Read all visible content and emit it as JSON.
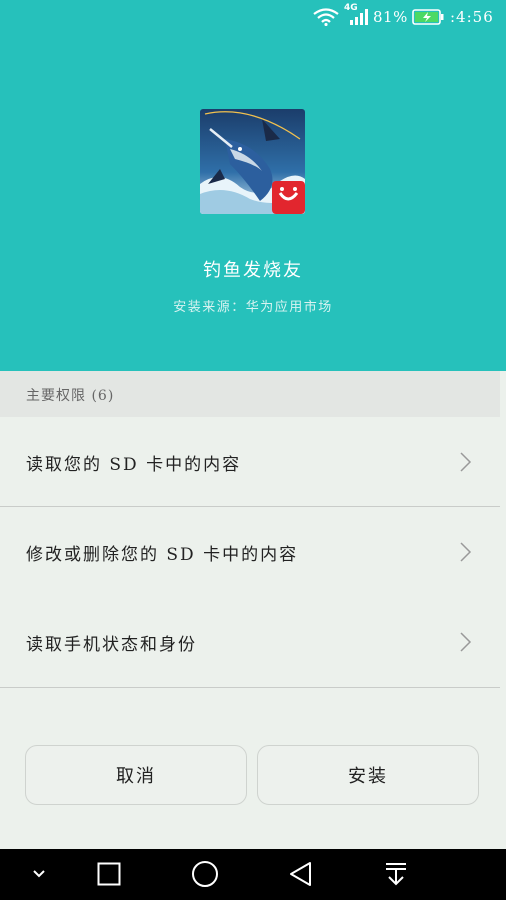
{
  "status_bar": {
    "network": "4G",
    "battery": "81%",
    "time": ":4:56"
  },
  "app": {
    "name": "钓鱼发烧友",
    "source": "安装来源：华为应用市场"
  },
  "permissions": {
    "header": "主要权限 (6)",
    "items": [
      {
        "label": "读取您的 SD 卡中的内容"
      },
      {
        "label": "修改或删除您的 SD 卡中的内容"
      },
      {
        "label": "读取手机状态和身份"
      }
    ]
  },
  "buttons": {
    "cancel": "取消",
    "install": "安装"
  },
  "colors": {
    "header_bg": "#26C1BB",
    "body_bg": "#ECF1EC",
    "battery_green": "#4CD964"
  }
}
